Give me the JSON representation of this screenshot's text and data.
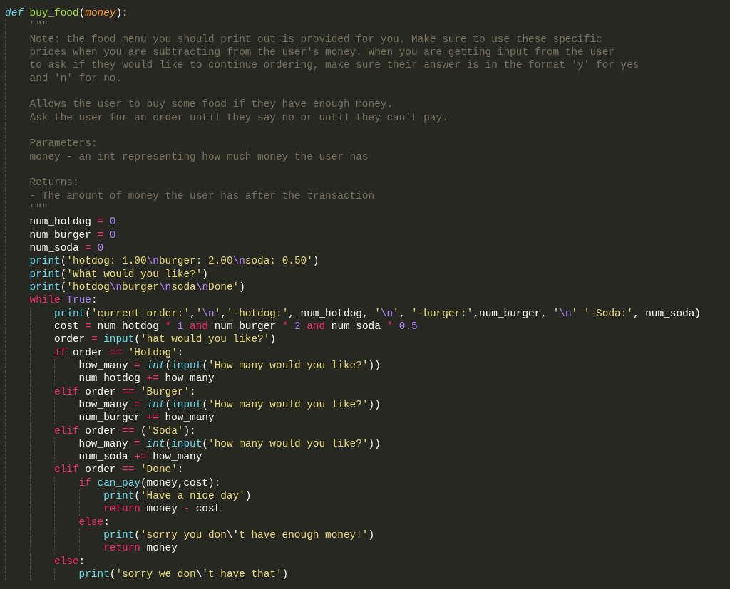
{
  "editor": {
    "lines": [
      {
        "kind": "code",
        "tokens": [
          {
            "kind": "def",
            "text": "def "
          },
          {
            "kind": "function",
            "text": "buy_food"
          },
          {
            "kind": "plain",
            "text": "("
          },
          {
            "kind": "param",
            "text": "money"
          },
          {
            "kind": "plain",
            "text": "):"
          }
        ],
        "children": [
          {
            "kind": "code",
            "tokens": [
              {
                "kind": "comment",
                "text": "\"\"\""
              }
            ]
          },
          {
            "kind": "code",
            "tokens": [
              {
                "kind": "comment",
                "text": "Note: the food menu you should print out is provided for you. Make sure to use these specific"
              }
            ]
          },
          {
            "kind": "code",
            "tokens": [
              {
                "kind": "comment",
                "text": "prices when you are subtracting from the user's money. When you are getting input from the user"
              }
            ]
          },
          {
            "kind": "code",
            "tokens": [
              {
                "kind": "comment",
                "text": "to ask if they would like to continue ordering, make sure their answer is in the format 'y' for yes"
              }
            ]
          },
          {
            "kind": "code",
            "tokens": [
              {
                "kind": "comment",
                "text": "and 'n' for no."
              }
            ]
          },
          {
            "kind": "blank"
          },
          {
            "kind": "code",
            "tokens": [
              {
                "kind": "comment",
                "text": "Allows the user to buy some food if they have enough money."
              }
            ]
          },
          {
            "kind": "code",
            "tokens": [
              {
                "kind": "comment",
                "text": "Ask the user for an order until they say no or until they can't pay."
              }
            ]
          },
          {
            "kind": "blank"
          },
          {
            "kind": "code",
            "tokens": [
              {
                "kind": "comment",
                "text": "Parameters:"
              }
            ]
          },
          {
            "kind": "code",
            "tokens": [
              {
                "kind": "comment",
                "text": "money - an int representing how much money the user has"
              }
            ]
          },
          {
            "kind": "blank"
          },
          {
            "kind": "code",
            "tokens": [
              {
                "kind": "comment",
                "text": "Returns:"
              }
            ]
          },
          {
            "kind": "code",
            "tokens": [
              {
                "kind": "comment",
                "text": "- The amount of money the user has after the transaction"
              }
            ]
          },
          {
            "kind": "code",
            "tokens": [
              {
                "kind": "comment",
                "text": "\"\"\""
              }
            ]
          },
          {
            "kind": "code",
            "tokens": [
              {
                "kind": "plain",
                "text": "num_hotdog"
              },
              {
                "kind": "operator",
                "text": " = "
              },
              {
                "kind": "number",
                "text": "0"
              }
            ]
          },
          {
            "kind": "code",
            "tokens": [
              {
                "kind": "plain",
                "text": "num_burger"
              },
              {
                "kind": "operator",
                "text": " = "
              },
              {
                "kind": "number",
                "text": "0"
              }
            ]
          },
          {
            "kind": "code",
            "tokens": [
              {
                "kind": "plain",
                "text": "num_soda"
              },
              {
                "kind": "operator",
                "text": " = "
              },
              {
                "kind": "number",
                "text": "0"
              }
            ]
          },
          {
            "kind": "code",
            "tokens": [
              {
                "kind": "builtin",
                "text": "print"
              },
              {
                "kind": "plain",
                "text": "("
              },
              {
                "kind": "string",
                "text": "'hotdog: 1.00"
              },
              {
                "kind": "escape",
                "text": "\\n"
              },
              {
                "kind": "string",
                "text": "burger: 2.00"
              },
              {
                "kind": "escape",
                "text": "\\n"
              },
              {
                "kind": "string",
                "text": "soda: 0.50'"
              },
              {
                "kind": "plain",
                "text": ")"
              }
            ]
          },
          {
            "kind": "code",
            "tokens": [
              {
                "kind": "builtin",
                "text": "print"
              },
              {
                "kind": "plain",
                "text": "("
              },
              {
                "kind": "string",
                "text": "'What would you like?'"
              },
              {
                "kind": "plain",
                "text": ")"
              }
            ]
          },
          {
            "kind": "code",
            "tokens": [
              {
                "kind": "builtin",
                "text": "print"
              },
              {
                "kind": "plain",
                "text": "("
              },
              {
                "kind": "string",
                "text": "'hotdog"
              },
              {
                "kind": "escape",
                "text": "\\n"
              },
              {
                "kind": "string",
                "text": "burger"
              },
              {
                "kind": "escape",
                "text": "\\n"
              },
              {
                "kind": "string",
                "text": "soda"
              },
              {
                "kind": "escape",
                "text": "\\n"
              },
              {
                "kind": "string",
                "text": "Done'"
              },
              {
                "kind": "plain",
                "text": ")"
              }
            ]
          },
          {
            "kind": "code",
            "tokens": [
              {
                "kind": "keyword",
                "text": "while "
              },
              {
                "kind": "number",
                "text": "True"
              },
              {
                "kind": "plain",
                "text": ":"
              }
            ],
            "children": [
              {
                "kind": "code",
                "tokens": [
                  {
                    "kind": "builtin",
                    "text": "print"
                  },
                  {
                    "kind": "plain",
                    "text": "("
                  },
                  {
                    "kind": "string",
                    "text": "'current order:'"
                  },
                  {
                    "kind": "plain",
                    "text": ","
                  },
                  {
                    "kind": "string",
                    "text": "'"
                  },
                  {
                    "kind": "escape",
                    "text": "\\n"
                  },
                  {
                    "kind": "string",
                    "text": "'"
                  },
                  {
                    "kind": "plain",
                    "text": ","
                  },
                  {
                    "kind": "string",
                    "text": "'-hotdog:'"
                  },
                  {
                    "kind": "plain",
                    "text": ", num_hotdog, "
                  },
                  {
                    "kind": "string",
                    "text": "'"
                  },
                  {
                    "kind": "escape",
                    "text": "\\n"
                  },
                  {
                    "kind": "string",
                    "text": "'"
                  },
                  {
                    "kind": "plain",
                    "text": ", "
                  },
                  {
                    "kind": "string",
                    "text": "'-burger:'"
                  },
                  {
                    "kind": "plain",
                    "text": ",num_burger, "
                  },
                  {
                    "kind": "string",
                    "text": "'"
                  },
                  {
                    "kind": "escape",
                    "text": "\\n"
                  },
                  {
                    "kind": "string",
                    "text": "' '-Soda:'"
                  },
                  {
                    "kind": "plain",
                    "text": ", num_soda)"
                  }
                ]
              },
              {
                "kind": "code",
                "tokens": [
                  {
                    "kind": "plain",
                    "text": "cost"
                  },
                  {
                    "kind": "operator",
                    "text": " = "
                  },
                  {
                    "kind": "plain",
                    "text": "num_hotdog"
                  },
                  {
                    "kind": "operator",
                    "text": " * "
                  },
                  {
                    "kind": "number",
                    "text": "1"
                  },
                  {
                    "kind": "keyword",
                    "text": " and "
                  },
                  {
                    "kind": "plain",
                    "text": "num_burger"
                  },
                  {
                    "kind": "operator",
                    "text": " * "
                  },
                  {
                    "kind": "number",
                    "text": "2"
                  },
                  {
                    "kind": "keyword",
                    "text": " and "
                  },
                  {
                    "kind": "plain",
                    "text": "num_soda"
                  },
                  {
                    "kind": "operator",
                    "text": " * "
                  },
                  {
                    "kind": "number",
                    "text": "0.5"
                  }
                ]
              },
              {
                "kind": "code",
                "tokens": [
                  {
                    "kind": "plain",
                    "text": "order"
                  },
                  {
                    "kind": "operator",
                    "text": " = "
                  },
                  {
                    "kind": "builtin",
                    "text": "input"
                  },
                  {
                    "kind": "plain",
                    "text": "("
                  },
                  {
                    "kind": "string",
                    "text": "'hat would you like?'"
                  },
                  {
                    "kind": "plain",
                    "text": ")"
                  }
                ]
              },
              {
                "kind": "code",
                "tokens": [
                  {
                    "kind": "keyword",
                    "text": "if"
                  },
                  {
                    "kind": "plain",
                    "text": " order"
                  },
                  {
                    "kind": "operator",
                    "text": " == "
                  },
                  {
                    "kind": "string",
                    "text": "'Hotdog'"
                  },
                  {
                    "kind": "plain",
                    "text": ":"
                  }
                ],
                "children": [
                  {
                    "kind": "code",
                    "tokens": [
                      {
                        "kind": "plain",
                        "text": "how_many"
                      },
                      {
                        "kind": "operator",
                        "text": " = "
                      },
                      {
                        "kind": "type",
                        "text": "int"
                      },
                      {
                        "kind": "plain",
                        "text": "("
                      },
                      {
                        "kind": "builtin",
                        "text": "input"
                      },
                      {
                        "kind": "plain",
                        "text": "("
                      },
                      {
                        "kind": "string",
                        "text": "'How many would you like?'"
                      },
                      {
                        "kind": "plain",
                        "text": "))"
                      }
                    ]
                  },
                  {
                    "kind": "code",
                    "tokens": [
                      {
                        "kind": "plain",
                        "text": "num_hotdog"
                      },
                      {
                        "kind": "operator",
                        "text": " += "
                      },
                      {
                        "kind": "plain",
                        "text": "how_many"
                      }
                    ]
                  }
                ]
              },
              {
                "kind": "code",
                "tokens": [
                  {
                    "kind": "keyword",
                    "text": "elif"
                  },
                  {
                    "kind": "plain",
                    "text": " order"
                  },
                  {
                    "kind": "operator",
                    "text": " == "
                  },
                  {
                    "kind": "string",
                    "text": "'Burger'"
                  },
                  {
                    "kind": "plain",
                    "text": ":"
                  }
                ],
                "children": [
                  {
                    "kind": "code",
                    "tokens": [
                      {
                        "kind": "plain",
                        "text": "how_many"
                      },
                      {
                        "kind": "operator",
                        "text": " = "
                      },
                      {
                        "kind": "type",
                        "text": "int"
                      },
                      {
                        "kind": "plain",
                        "text": "("
                      },
                      {
                        "kind": "builtin",
                        "text": "input"
                      },
                      {
                        "kind": "plain",
                        "text": "("
                      },
                      {
                        "kind": "string",
                        "text": "'How many would you like?'"
                      },
                      {
                        "kind": "plain",
                        "text": "))"
                      }
                    ]
                  },
                  {
                    "kind": "code",
                    "tokens": [
                      {
                        "kind": "plain",
                        "text": "num_burger"
                      },
                      {
                        "kind": "operator",
                        "text": " += "
                      },
                      {
                        "kind": "plain",
                        "text": "how_many"
                      }
                    ]
                  }
                ]
              },
              {
                "kind": "code",
                "tokens": [
                  {
                    "kind": "keyword",
                    "text": "elif"
                  },
                  {
                    "kind": "plain",
                    "text": " order"
                  },
                  {
                    "kind": "operator",
                    "text": " == "
                  },
                  {
                    "kind": "plain",
                    "text": "("
                  },
                  {
                    "kind": "string",
                    "text": "'Soda'"
                  },
                  {
                    "kind": "plain",
                    "text": "):"
                  }
                ],
                "children": [
                  {
                    "kind": "code",
                    "tokens": [
                      {
                        "kind": "plain",
                        "text": "how_many"
                      },
                      {
                        "kind": "operator",
                        "text": " = "
                      },
                      {
                        "kind": "type",
                        "text": "int"
                      },
                      {
                        "kind": "plain",
                        "text": "("
                      },
                      {
                        "kind": "builtin",
                        "text": "input"
                      },
                      {
                        "kind": "plain",
                        "text": "("
                      },
                      {
                        "kind": "string",
                        "text": "'how many would you like?'"
                      },
                      {
                        "kind": "plain",
                        "text": "))"
                      }
                    ]
                  },
                  {
                    "kind": "code",
                    "tokens": [
                      {
                        "kind": "plain",
                        "text": "num_soda"
                      },
                      {
                        "kind": "operator",
                        "text": " += "
                      },
                      {
                        "kind": "plain",
                        "text": "how_many"
                      }
                    ]
                  }
                ]
              },
              {
                "kind": "code",
                "tokens": [
                  {
                    "kind": "keyword",
                    "text": "elif"
                  },
                  {
                    "kind": "plain",
                    "text": " order"
                  },
                  {
                    "kind": "operator",
                    "text": " == "
                  },
                  {
                    "kind": "string",
                    "text": "'Done'"
                  },
                  {
                    "kind": "plain",
                    "text": ":"
                  }
                ],
                "children": [
                  {
                    "kind": "code",
                    "tokens": [
                      {
                        "kind": "keyword",
                        "text": "if "
                      },
                      {
                        "kind": "builtin",
                        "text": "can_pay"
                      },
                      {
                        "kind": "plain",
                        "text": "(money,cost):"
                      }
                    ],
                    "children": [
                      {
                        "kind": "code",
                        "tokens": [
                          {
                            "kind": "builtin",
                            "text": "print"
                          },
                          {
                            "kind": "plain",
                            "text": "("
                          },
                          {
                            "kind": "string",
                            "text": "'Have a nice day'"
                          },
                          {
                            "kind": "plain",
                            "text": ")"
                          }
                        ]
                      },
                      {
                        "kind": "code",
                        "tokens": [
                          {
                            "kind": "keyword",
                            "text": "return"
                          },
                          {
                            "kind": "plain",
                            "text": " money"
                          },
                          {
                            "kind": "operator",
                            "text": " - "
                          },
                          {
                            "kind": "plain",
                            "text": "cost"
                          }
                        ]
                      }
                    ]
                  },
                  {
                    "kind": "code",
                    "tokens": [
                      {
                        "kind": "keyword",
                        "text": "else"
                      },
                      {
                        "kind": "plain",
                        "text": ":"
                      }
                    ],
                    "children": [
                      {
                        "kind": "code",
                        "tokens": [
                          {
                            "kind": "builtin",
                            "text": "print"
                          },
                          {
                            "kind": "plain",
                            "text": "("
                          },
                          {
                            "kind": "string",
                            "text": "'sorry you don"
                          },
                          {
                            "kind": "plain",
                            "text": "\\'"
                          },
                          {
                            "kind": "string",
                            "text": "t have enough money!'"
                          },
                          {
                            "kind": "plain",
                            "text": ")"
                          }
                        ]
                      },
                      {
                        "kind": "code",
                        "tokens": [
                          {
                            "kind": "keyword",
                            "text": "return"
                          },
                          {
                            "kind": "plain",
                            "text": " money"
                          }
                        ]
                      }
                    ]
                  }
                ]
              },
              {
                "kind": "code",
                "tokens": [
                  {
                    "kind": "keyword",
                    "text": "else"
                  },
                  {
                    "kind": "plain",
                    "text": ":"
                  }
                ],
                "children": [
                  {
                    "kind": "code",
                    "tokens": [
                      {
                        "kind": "builtin",
                        "text": "print"
                      },
                      {
                        "kind": "plain",
                        "text": "("
                      },
                      {
                        "kind": "string",
                        "text": "'sorry we don"
                      },
                      {
                        "kind": "plain",
                        "text": "\\'"
                      },
                      {
                        "kind": "string",
                        "text": "t have that'"
                      },
                      {
                        "kind": "plain",
                        "text": ")"
                      }
                    ]
                  }
                ]
              }
            ]
          }
        ]
      }
    ]
  }
}
